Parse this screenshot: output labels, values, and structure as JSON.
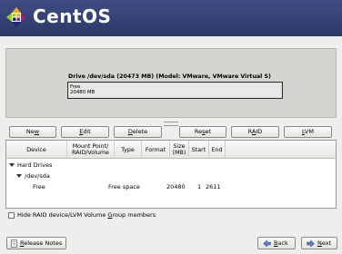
{
  "header": {
    "brand": "CentOS"
  },
  "drive": {
    "title": "Drive /dev/sda (20473 MB) (Model: VMware, VMware Virtual S)",
    "segment_label": "Free",
    "segment_size": "20480 MB"
  },
  "toolbar": {
    "new": {
      "pre": "Ne",
      "key": "w",
      "post": ""
    },
    "edit": {
      "pre": "",
      "key": "E",
      "post": "dit"
    },
    "delete": {
      "pre": "",
      "key": "D",
      "post": "elete"
    },
    "reset": {
      "pre": "Re",
      "key": "s",
      "post": "et"
    },
    "raid": {
      "pre": "R",
      "key": "A",
      "post": "ID"
    },
    "lvm": {
      "pre": "",
      "key": "L",
      "post": "VM"
    }
  },
  "table": {
    "headers": {
      "device": "Device",
      "mount": "Mount Point/\nRAID/Volume",
      "type": "Type",
      "format": "Format",
      "size": "Size\n(MB)",
      "start": "Start",
      "end": "End"
    },
    "rows": {
      "group": "Hard Drives",
      "disk": "/dev/sda",
      "free": {
        "device": "Free",
        "type": "Free space",
        "size": "20480",
        "start": "1",
        "end": "2611"
      }
    }
  },
  "options": {
    "hide_raid_pre": "Hide RAID device/LVM Volume ",
    "hide_raid_key": "G",
    "hide_raid_post": "roup members",
    "hide_raid_checked": false
  },
  "footer": {
    "release_notes_pre": "",
    "release_notes_key": "R",
    "release_notes_post": "elease Notes",
    "back_pre": "",
    "back_key": "B",
    "back_post": "ack",
    "next_pre": "",
    "next_key": "N",
    "next_post": "ext"
  },
  "colors": {
    "banner": "#3f4d83",
    "background": "#eeeeec"
  },
  "icons": {
    "logo": "centos-logo-icon",
    "release_notes": "document-icon",
    "back": "arrow-left-icon",
    "next": "arrow-right-icon"
  }
}
